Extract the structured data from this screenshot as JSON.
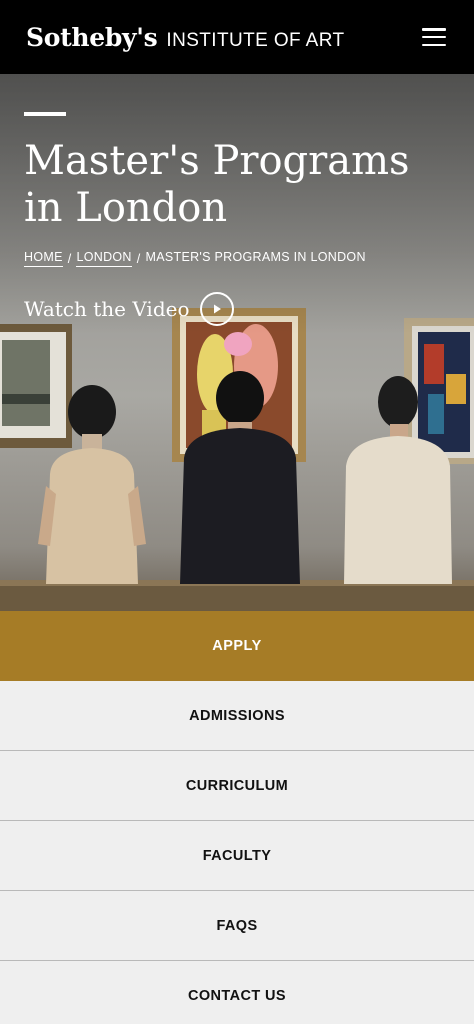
{
  "header": {
    "brand_main": "Sotheby's",
    "brand_sub": "INSTITUTE OF ART",
    "menu_icon": "hamburger-menu-icon"
  },
  "hero": {
    "title": "Master's Programs in London",
    "breadcrumbs": [
      "HOME",
      "LONDON",
      "MASTER'S PROGRAMS IN LONDON"
    ],
    "breadcrumb_separator": "/",
    "video_label": "Watch the Video",
    "video_icon": "play-circle-icon"
  },
  "apply": {
    "label": "APPLY",
    "color": "#a67c26"
  },
  "nav": {
    "items": [
      "ADMISSIONS",
      "CURRICULUM",
      "FACULTY",
      "FAQS",
      "CONTACT US"
    ]
  }
}
